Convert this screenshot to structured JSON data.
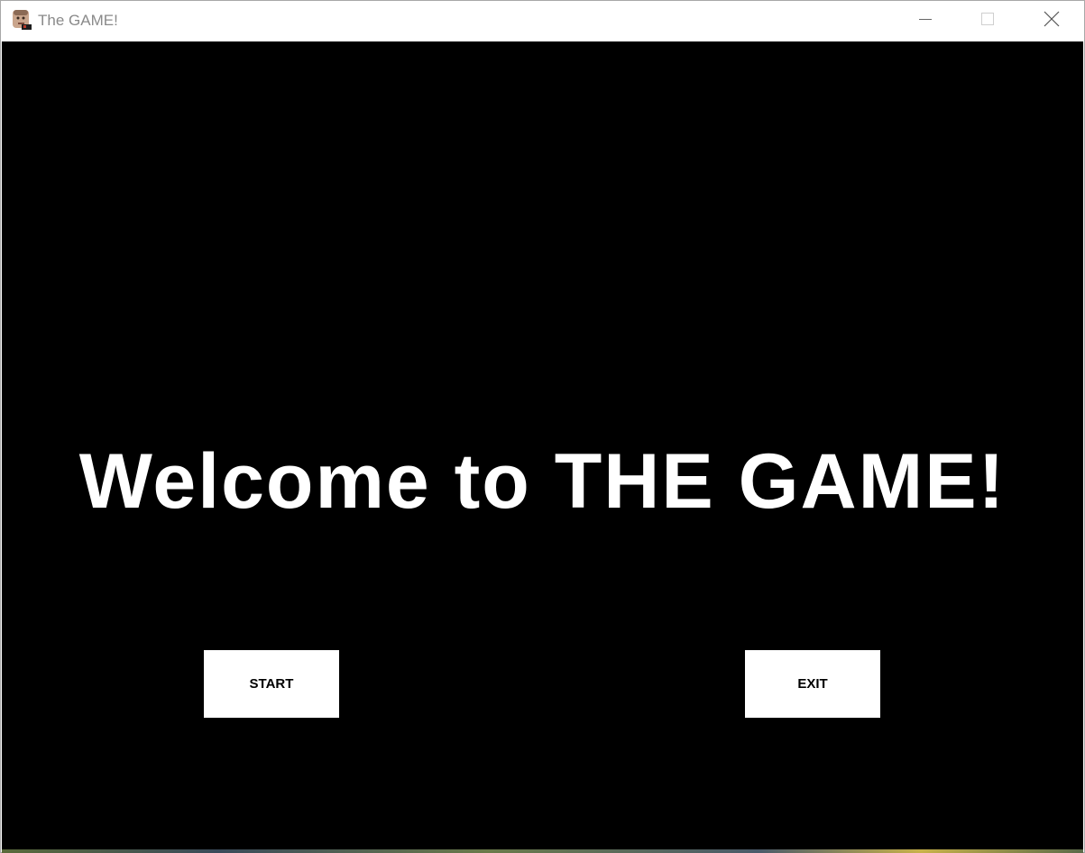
{
  "window": {
    "title": "The GAME!",
    "app_icon": "app-face-icon",
    "controls": {
      "minimize_icon": "minimize-icon",
      "maximize_icon": "maximize-icon",
      "close_icon": "close-icon"
    }
  },
  "screen": {
    "background_color": "#000000",
    "heading": "Welcome to THE GAME!",
    "buttons": {
      "start_label": "START",
      "exit_label": "EXIT"
    }
  }
}
